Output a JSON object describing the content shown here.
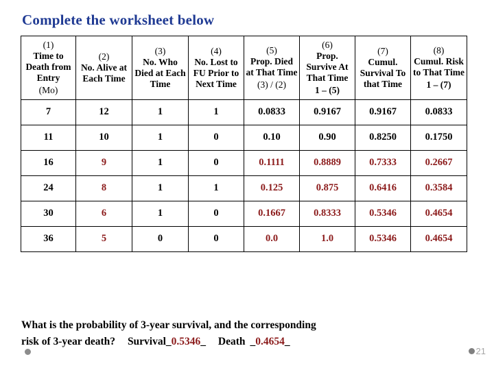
{
  "slide": {
    "title": "Complete the worksheet below",
    "title_color": "#1F3A93",
    "accent_red": "#8B1A1A",
    "page_number": "21"
  },
  "table": {
    "headers": [
      {
        "number": "(1)",
        "name": "Time to Death from Entry",
        "formula": "(Mo)",
        "formula_bold": false
      },
      {
        "number": "(2)",
        "name": "No. Alive at Each Time",
        "formula": "",
        "formula_bold": false
      },
      {
        "number": "(3)",
        "name": "No. Who Died at Each Time",
        "formula": "",
        "formula_bold": false
      },
      {
        "number": "(4)",
        "name": "No. Lost to FU Prior to Next Time",
        "formula": "",
        "formula_bold": false
      },
      {
        "number": "(5)",
        "name": "Prop. Died at That Time",
        "formula": "(3) / (2)",
        "formula_bold": false
      },
      {
        "number": "(6)",
        "name": "Prop. Survive At That Time",
        "formula": "1 – (5)",
        "formula_bold": true
      },
      {
        "number": "(7)",
        "name": "Cumul. Survival To that Time",
        "formula": "",
        "formula_bold": false
      },
      {
        "number": "(8)",
        "name": "Cumul. Risk to That Time",
        "formula": "1 – (7)",
        "formula_bold": true
      }
    ],
    "rows": [
      {
        "cells": [
          "7",
          "12",
          "1",
          "1",
          "0.0833",
          "0.9167",
          "0.9167",
          "0.0833"
        ],
        "colors": [
          "black",
          "black",
          "black",
          "black",
          "black",
          "black",
          "black",
          "black"
        ]
      },
      {
        "cells": [
          "11",
          "10",
          "1",
          "0",
          "0.10",
          "0.90",
          "0.8250",
          "0.1750"
        ],
        "colors": [
          "black",
          "black",
          "black",
          "black",
          "black",
          "black",
          "black",
          "black"
        ]
      },
      {
        "cells": [
          "16",
          "9",
          "1",
          "0",
          "0.1111",
          "0.8889",
          "0.7333",
          "0.2667"
        ],
        "colors": [
          "black",
          "red",
          "black",
          "black",
          "red",
          "red",
          "red",
          "red"
        ]
      },
      {
        "cells": [
          "24",
          "8",
          "1",
          "1",
          "0.125",
          "0.875",
          "0.6416",
          "0.3584"
        ],
        "colors": [
          "black",
          "red",
          "black",
          "black",
          "red",
          "red",
          "red",
          "red"
        ]
      },
      {
        "cells": [
          "30",
          "6",
          "1",
          "0",
          "0.1667",
          "0.8333",
          "0.5346",
          "0.4654"
        ],
        "colors": [
          "black",
          "red",
          "black",
          "black",
          "red",
          "red",
          "red",
          "red"
        ]
      },
      {
        "cells": [
          "36",
          "5",
          "0",
          "0",
          "0.0",
          "1.0",
          "0.5346",
          "0.4654"
        ],
        "colors": [
          "black",
          "red",
          "black",
          "black",
          "red",
          "red",
          "red",
          "red"
        ]
      }
    ]
  },
  "question": {
    "line1": "What is the probability of 3-year survival, and the corresponding",
    "line2_prefix": "risk of 3-year death?",
    "survival_label": "Survival",
    "survival_open": "_",
    "survival_value": "0.5346",
    "survival_close": "_",
    "death_label": "Death",
    "death_open": "_",
    "death_value": "0.4654",
    "death_close": "_"
  }
}
